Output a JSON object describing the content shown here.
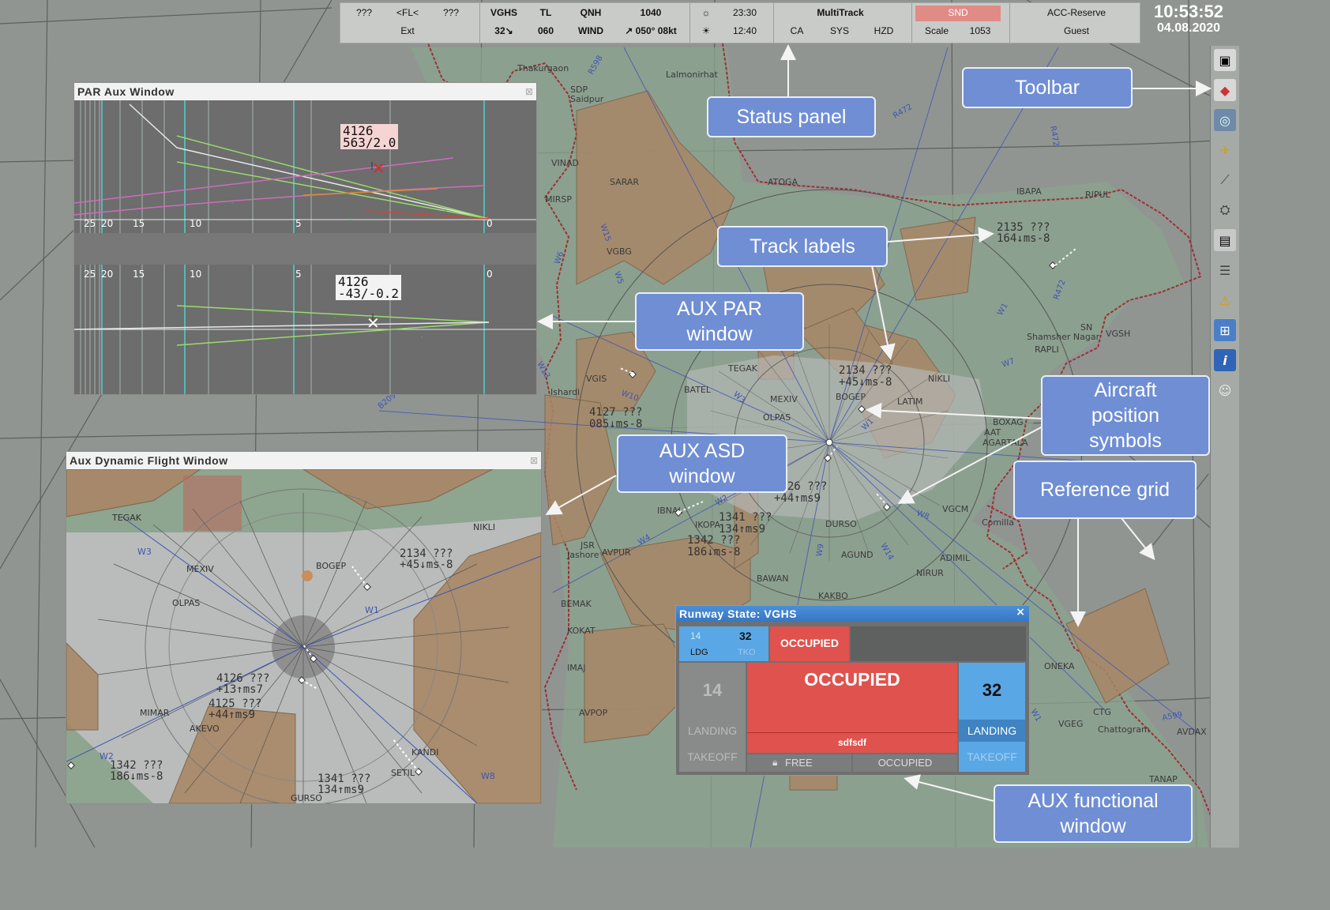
{
  "status_panel": {
    "row1": [
      "???",
      "<FL<",
      "???",
      "VGHS",
      "TL",
      "QNH",
      "1040",
      "23:30",
      "MultiTrack",
      "SND",
      "ACC-Reserve"
    ],
    "row2": [
      "Ext",
      "32↘",
      "060",
      "WIND",
      "↗ 050° 08kt",
      "12:40",
      "CA",
      "SYS",
      "HZD",
      "Scale",
      "1053",
      "Guest"
    ],
    "snd_color": "#e37b78"
  },
  "clock": {
    "time": "10:53:52",
    "date": "04.08.2020"
  },
  "map_labels": {
    "thakurgaon": "Thakurgaon",
    "lalmonirhat": "Lalmonirhat",
    "saidpur": "Saidpur",
    "sdp": "SDP",
    "vinad": "VINAD",
    "sarar": "SARAR",
    "mirsp": "MIRSP",
    "atoga": "ATOGA",
    "ibapa": "IBAPA",
    "ripul": "RIPUL",
    "vgbg": "VGBG",
    "vgis": "VGIS",
    "ishardi": "Ishardi",
    "tegak": "TEGAK",
    "batel": "BATEL",
    "mexiv": "MEXIV",
    "bogep": "BOGEP",
    "olpas": "OLPAS",
    "latim": "LATIM",
    "nikli": "NIKLI",
    "shamsher": "Shamsher Nagar",
    "vgsh": "VGSH",
    "sn": "SN",
    "rapli": "RAPLI",
    "jsr": "JSR",
    "jashore": "Jashore",
    "avpur": "AVPUR",
    "bemak": "BEMAK",
    "kokat": "KOKAT",
    "bawan": "BAWAN",
    "agund": "AGUND",
    "adimil": "ADIMIL",
    "nirur": "NIRUR",
    "kakbo": "KAKBO",
    "dursu": "DURSO",
    "vgcm": "VGCM",
    "comilla": "Comilla",
    "aat": "AAT",
    "agartala": "AGARTALA",
    "boxag": "BOXAG",
    "imaj": "IMAJ",
    "avpop": "AVPOP",
    "oneka": "ONEKA",
    "ctg": "CTG",
    "chattogram": "Chattogram",
    "vgeg": "VGEG",
    "avdax": "AVDAX",
    "tanap": "TANAP",
    "ikopa": "IKOPA",
    "ibnal": "IBNAL",
    "kandi": "KANDI"
  },
  "airways": [
    "R472",
    "R472",
    "R472",
    "R598",
    "W1",
    "W1",
    "W2",
    "W3",
    "W4",
    "W5",
    "W6",
    "W7",
    "W8",
    "W9",
    "W10",
    "W13",
    "W14",
    "W15",
    "B209",
    "A599",
    "W1"
  ],
  "track_labels": [
    {
      "callsign": "2135 ???",
      "info": "164↓ms-8"
    },
    {
      "callsign": "2134 ???",
      "info": "+45↓ms-8"
    },
    {
      "callsign": "4127 ???",
      "info": "085↓ms-8"
    },
    {
      "callsign": "4126 ???",
      "info": "+44↑ms9"
    },
    {
      "callsign": "1341 ???",
      "info": "134↑ms9"
    },
    {
      "callsign": "1342 ???",
      "info": "186↓ms-8"
    }
  ],
  "par_window": {
    "title": "PAR Aux Window",
    "close": "⊠",
    "top_scale": [
      "25",
      "20",
      "15",
      "10",
      "5",
      "0"
    ],
    "bottom_scale": [
      "25",
      "20",
      "15",
      "10",
      "5",
      "0"
    ],
    "top_tag": {
      "line1": "4126",
      "line2": "563/2.0"
    },
    "bottom_tag": {
      "line1": "4126",
      "line2": "-43/-0.2"
    }
  },
  "dyn_window": {
    "title": "Aux Dynamic Flight Window",
    "close": "⊠",
    "labels": {
      "tegak": "TEGAK",
      "mexiv": "MEXIV",
      "olpas": "OLPAS",
      "bogep": "BOGEP",
      "nikli": "NIKLI",
      "mimar": "MIMAR",
      "akevo": "AKEVO",
      "kandi": "KANDI",
      "setil": "SETIL",
      "gurso": "GURSO",
      "w8": "W8",
      "w3": "W3",
      "w1": "W1",
      "w2": "W2"
    },
    "tracks": [
      {
        "callsign": "2134 ???",
        "info": "+45↓ms-8"
      },
      {
        "callsign": "4126 ???",
        "info": "+13↑ms7"
      },
      {
        "callsign": "4125 ???",
        "info": "+44↑ms9"
      },
      {
        "callsign": "1342 ???",
        "info": "186↓ms-8"
      },
      {
        "callsign": "1341 ???",
        "info": "134↑ms9"
      }
    ]
  },
  "runway_window": {
    "title": "Runway State: VGHS",
    "close": "×",
    "mini": {
      "rwy_left": "14",
      "rwy_right": "32",
      "ldg": "LDG",
      "tko": "TKO",
      "state": "OCCUPIED"
    },
    "left_rwy": "14",
    "left_landing": "LANDING",
    "left_takeoff": "TAKEOFF",
    "main_state": "OCCUPIED",
    "main_note": "sdfsdf",
    "right_rwy": "32",
    "right_landing": "LANDING",
    "right_takeoff": "TAKEOFF",
    "btn_free": "FREE",
    "btn_occupied": "OCCUPIED",
    "occupied_color": "#e0524d",
    "blue_color": "#5aa7e6"
  },
  "toolbar_icons": [
    "window-icon",
    "layers-icon",
    "radar-icon",
    "airport-icon",
    "ruler-icon",
    "aircraft-icon",
    "map-settings-icon",
    "list-icon",
    "warning-icon",
    "panels-icon",
    "info-icon",
    "user-icon"
  ],
  "annotations": {
    "status_panel": "Status panel",
    "toolbar": "Toolbar",
    "track_labels": "Track labels",
    "aux_par": "AUX PAR window",
    "aux_asd": "AUX ASD window",
    "aircraft_pos": "Aircraft position symbols",
    "ref_grid": "Reference grid",
    "aux_func": "AUX functional window"
  }
}
